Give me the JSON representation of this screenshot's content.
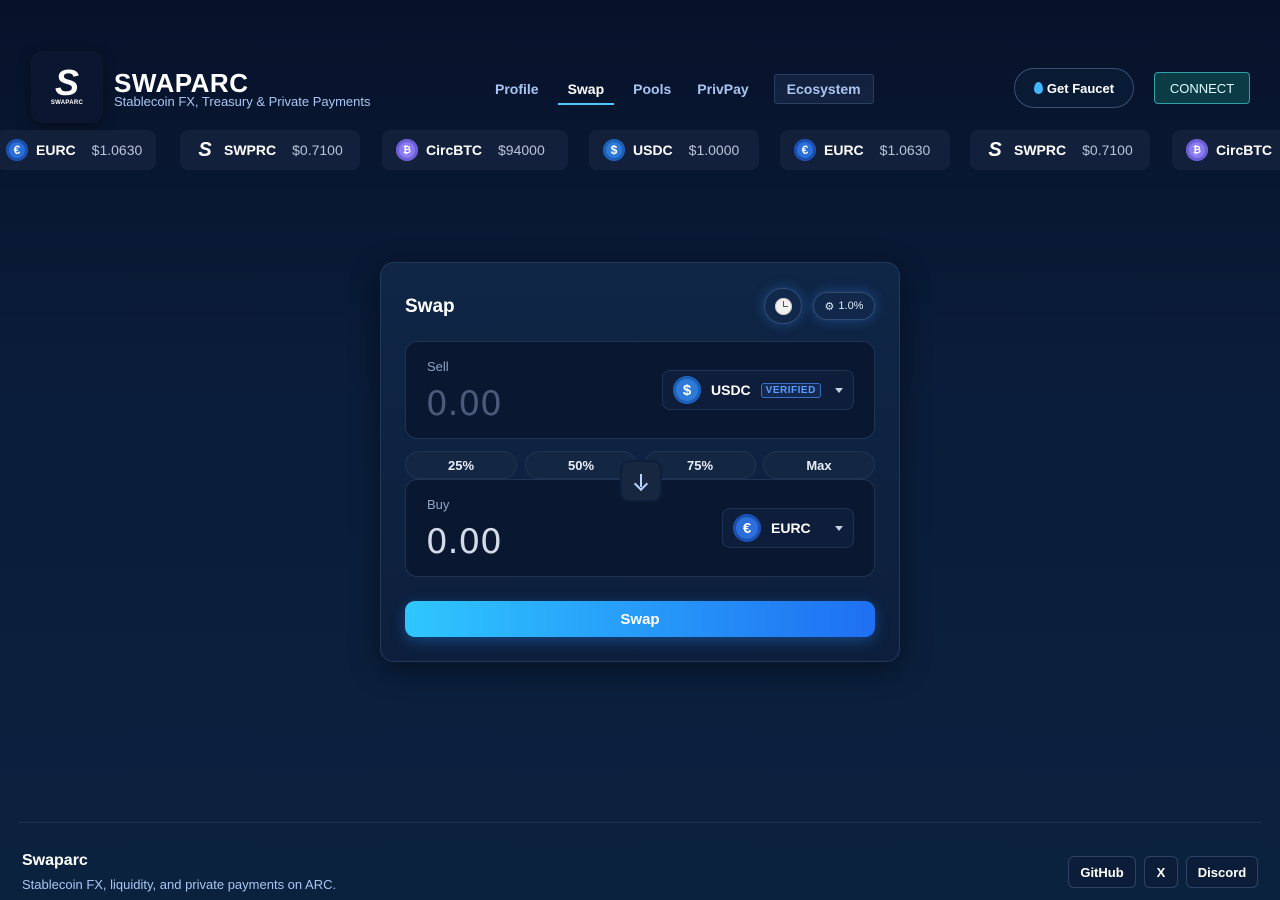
{
  "brand": {
    "logo_letter": "S",
    "logo_word": "SWAPARC",
    "title": "SWAPARC",
    "subtitle": "Stablecoin FX, Treasury & Private Payments"
  },
  "nav": {
    "items": [
      {
        "label": "Profile"
      },
      {
        "label": "Swap",
        "active": true
      },
      {
        "label": "Pools"
      },
      {
        "label": "PrivPay"
      },
      {
        "label": "Ecosystem"
      }
    ]
  },
  "header_actions": {
    "faucet_label": "Get Faucet",
    "connect_label": "CONNECT"
  },
  "ticker": [
    {
      "symbol": "EURC",
      "price": "$1.0630",
      "icon": "eurc-coin-icon"
    },
    {
      "symbol": "SWPRC",
      "price": "$0.7100",
      "icon": "swprc-logo-icon"
    },
    {
      "symbol": "CircBTC",
      "price": "$94000",
      "icon": "circbtc-coin-icon"
    },
    {
      "symbol": "USDC",
      "price": "$1.0000",
      "icon": "usdc-coin-icon"
    },
    {
      "symbol": "EURC",
      "price": "$1.0630",
      "icon": "eurc-coin-icon"
    },
    {
      "symbol": "SWPRC",
      "price": "$0.7100",
      "icon": "swprc-logo-icon"
    },
    {
      "symbol": "CircBTC",
      "price": "",
      "icon": "circbtc-coin-icon"
    }
  ],
  "swap": {
    "title": "Swap",
    "slippage": "1.0%",
    "sell": {
      "label": "Sell",
      "placeholder": "0.00",
      "token": "USDC",
      "badge": "VERIFIED"
    },
    "percent_buttons": [
      "25%",
      "50%",
      "75%",
      "Max"
    ],
    "buy": {
      "label": "Buy",
      "amount": "0.00",
      "token": "EURC"
    },
    "submit_label": "Swap"
  },
  "footer": {
    "title": "Swaparc",
    "subtitle": "Stablecoin FX, liquidity, and private payments on ARC.",
    "links": [
      "GitHub",
      "X",
      "Discord"
    ]
  },
  "colors": {
    "accent": "#4fc6ff",
    "swap_gradient_start": "#2fc7ff",
    "swap_gradient_end": "#1f6ff2",
    "verified": "#5a9cff"
  }
}
